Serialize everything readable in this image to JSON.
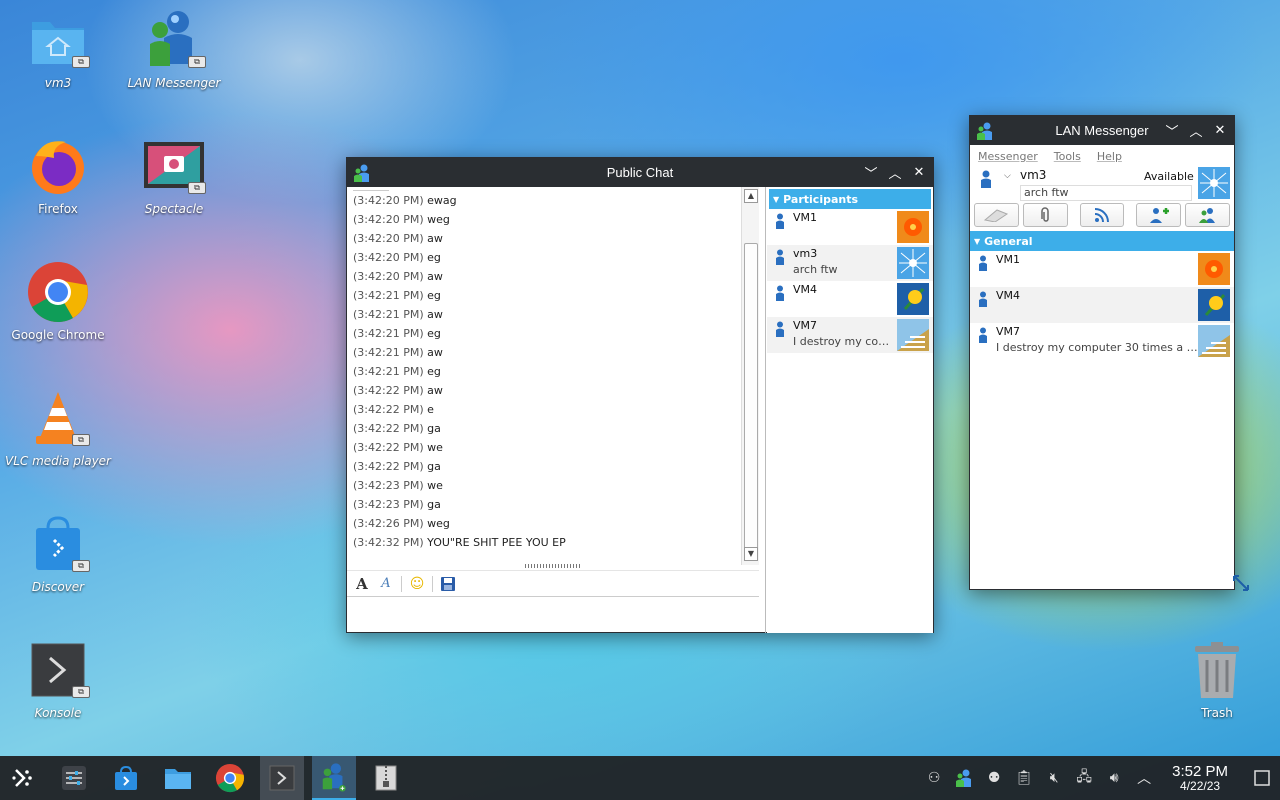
{
  "desktop": {
    "icons": [
      {
        "label": "vm3",
        "icon": "home-folder-icon"
      },
      {
        "label": "LAN Messenger",
        "icon": "lan-messenger-icon"
      },
      {
        "label": "Firefox",
        "icon": "firefox-icon"
      },
      {
        "label": "Spectacle",
        "icon": "spectacle-icon"
      },
      {
        "label": "Google Chrome",
        "icon": "chrome-icon"
      },
      {
        "label": "VLC media player",
        "icon": "vlc-icon"
      },
      {
        "label": "Discover",
        "icon": "discover-icon"
      },
      {
        "label": "Konsole",
        "icon": "konsole-icon"
      },
      {
        "label": "Trash",
        "icon": "trash-icon"
      }
    ]
  },
  "public_chat": {
    "title": "Public Chat",
    "messages": [
      {
        "time": "(3:42:20 PM)",
        "text": "ewag"
      },
      {
        "time": "(3:42:20 PM)",
        "text": "weg"
      },
      {
        "time": "(3:42:20 PM)",
        "text": "aw"
      },
      {
        "time": "(3:42:20 PM)",
        "text": "eg"
      },
      {
        "time": "(3:42:20 PM)",
        "text": "aw"
      },
      {
        "time": "(3:42:21 PM)",
        "text": "eg"
      },
      {
        "time": "(3:42:21 PM)",
        "text": "aw"
      },
      {
        "time": "(3:42:21 PM)",
        "text": "eg"
      },
      {
        "time": "(3:42:21 PM)",
        "text": "aw"
      },
      {
        "time": "(3:42:21 PM)",
        "text": "eg"
      },
      {
        "time": "(3:42:22 PM)",
        "text": "aw"
      },
      {
        "time": "(3:42:22 PM)",
        "text": "e"
      },
      {
        "time": "(3:42:22 PM)",
        "text": "ga"
      },
      {
        "time": "(3:42:22 PM)",
        "text": "we"
      },
      {
        "time": "(3:42:22 PM)",
        "text": "ga"
      },
      {
        "time": "(3:42:23 PM)",
        "text": "we"
      },
      {
        "time": "(3:42:23 PM)",
        "text": "ga"
      },
      {
        "time": "(3:42:26 PM)",
        "text": "weg"
      },
      {
        "time": "(3:42:32 PM)",
        "text": "YOU\"RE SHIT PEE YOU EP"
      }
    ],
    "participants_header": "Participants",
    "participants": [
      {
        "name": "VM1",
        "note": ""
      },
      {
        "name": "vm3",
        "note": "arch ftw"
      },
      {
        "name": "VM4",
        "note": ""
      },
      {
        "name": "VM7",
        "note": "I destroy my com..."
      }
    ]
  },
  "lan_messenger": {
    "title": "LAN Messenger",
    "menu": [
      "Messenger",
      "Tools",
      "Help"
    ],
    "me": {
      "name": "vm3",
      "status": "Available",
      "note": "arch ftw"
    },
    "group_header": "General",
    "contacts": [
      {
        "name": "VM1",
        "note": ""
      },
      {
        "name": "VM4",
        "note": ""
      },
      {
        "name": "VM7",
        "note": "I destroy my computer 30 times a da ..."
      }
    ]
  },
  "taskbar": {
    "time": "3:52 PM",
    "date": "4/22/23"
  },
  "colors": {
    "accent": "#3daee9",
    "titlebar": "#2a2e32",
    "taskbar": "#202327"
  }
}
